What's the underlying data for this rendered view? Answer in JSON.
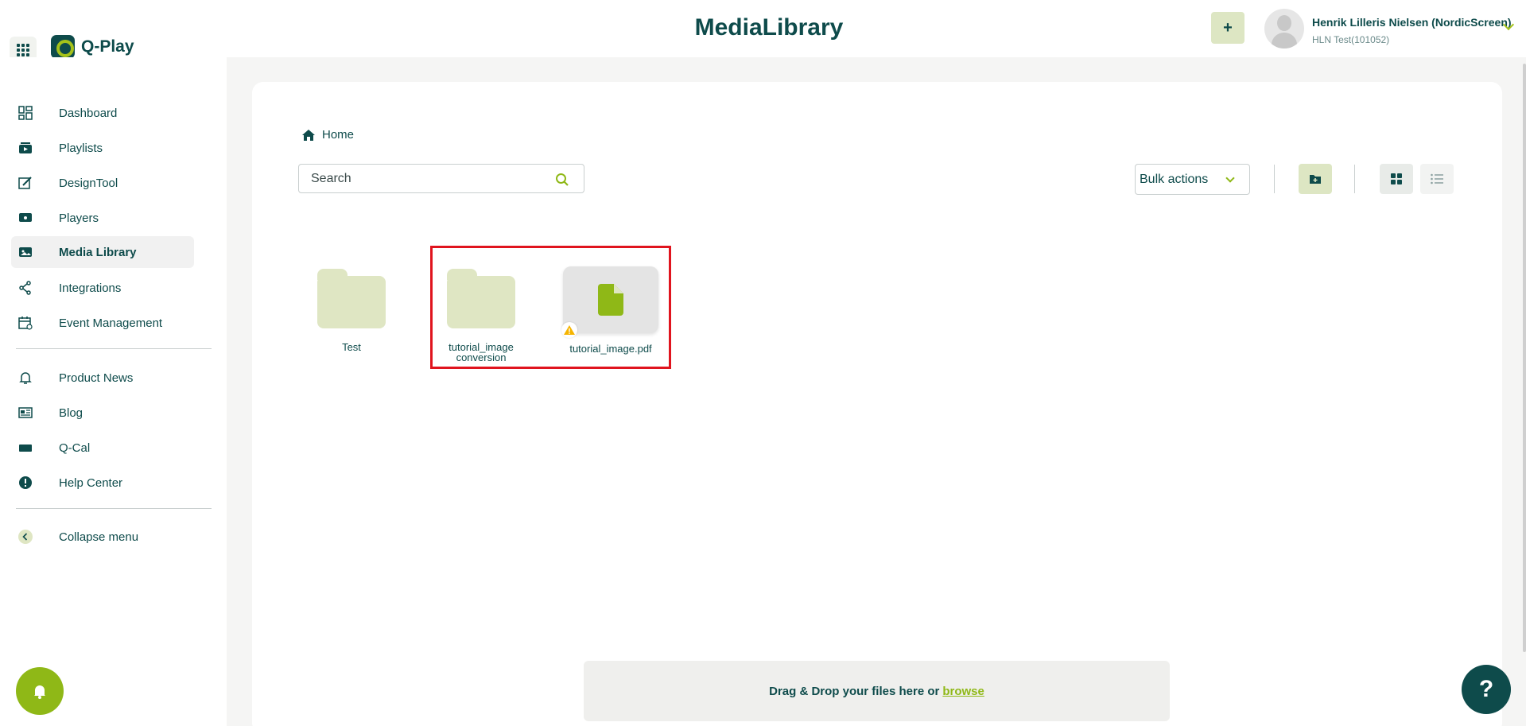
{
  "header": {
    "app_name": "Q-Play",
    "page_title": "MediaLibrary",
    "add_label": "+",
    "user_name": "Henrik Lilleris Nielsen (NordicScreen)",
    "user_org": "HLN Test(101052)"
  },
  "sidebar": {
    "items": [
      {
        "label": "Dashboard",
        "icon": "dashboard-icon"
      },
      {
        "label": "Playlists",
        "icon": "playlist-icon"
      },
      {
        "label": "DesignTool",
        "icon": "design-icon"
      },
      {
        "label": "Players",
        "icon": "player-icon"
      },
      {
        "label": "Media Library",
        "icon": "media-icon",
        "active": true
      },
      {
        "label": "Integrations",
        "icon": "share-icon"
      },
      {
        "label": "Event Management",
        "icon": "calendar-icon"
      },
      {
        "label": "Product News",
        "icon": "bell-icon"
      },
      {
        "label": "Blog",
        "icon": "newspaper-icon"
      },
      {
        "label": "Q-Cal",
        "icon": "rectangle-icon"
      },
      {
        "label": "Help Center",
        "icon": "alert-icon"
      },
      {
        "label": "Collapse menu",
        "icon": "chevron-left-icon"
      }
    ]
  },
  "main": {
    "breadcrumb": "Home",
    "search_placeholder": "Search",
    "bulk_actions": "Bulk actions",
    "items": [
      {
        "type": "folder",
        "label_line1": "Test",
        "label_line2": ""
      },
      {
        "type": "folder",
        "label_line1": "tutorial_image",
        "label_line2": "conversion"
      },
      {
        "type": "file",
        "label_line1": "tutorial_image.pdf",
        "label_line2": ""
      }
    ],
    "dropzone_text": "Drag & Drop your files here or",
    "dropzone_link": "browse"
  },
  "help_label": "?",
  "colors": {
    "brand_dark": "#0e4b4b",
    "brand_green": "#8fb817",
    "folder": "#dfe6c3",
    "highlight": "#e0141e"
  }
}
